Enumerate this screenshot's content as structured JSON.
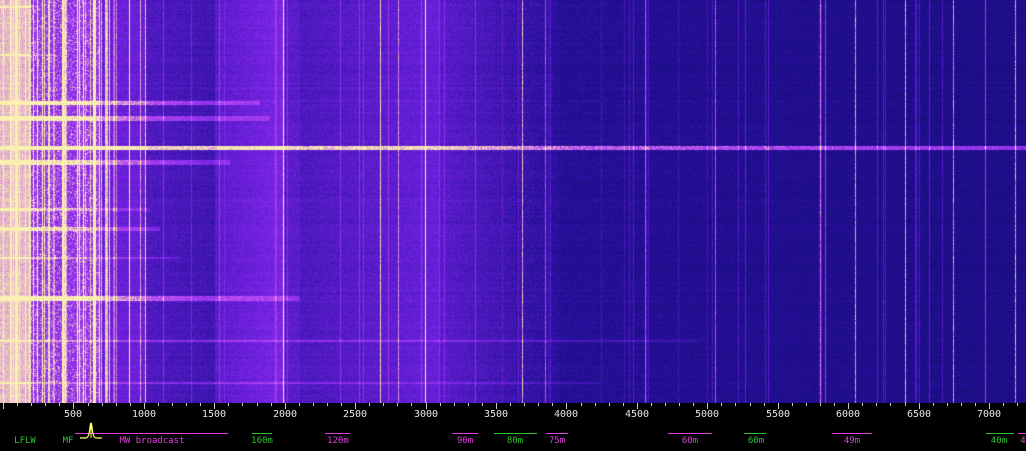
{
  "waterfall": {
    "unit_hint": "kHz",
    "colors": {
      "background": "#0a0a50",
      "mid": "#6a22d8",
      "hot": "#b040f0",
      "peak": "#f0f0b0"
    }
  },
  "frequency_scale": {
    "labels": [
      "500",
      "1000",
      "1500",
      "2000",
      "2500",
      "3000",
      "3500",
      "4000",
      "4500",
      "5000",
      "5500",
      "6000",
      "6500",
      "7000"
    ],
    "values_khz": [
      500,
      1000,
      1500,
      2000,
      2500,
      3000,
      3500,
      4000,
      4500,
      5000,
      5500,
      6000,
      6500,
      7000
    ]
  },
  "bands": [
    {
      "id": "lflw",
      "label": "LFLW",
      "color": "#2ec42e"
    },
    {
      "id": "mf",
      "label": "MF",
      "color": "#2ec42e"
    },
    {
      "id": "mw",
      "label": "MW broadcast",
      "color": "#e040e0"
    },
    {
      "id": "160m",
      "label": "160m",
      "color": "#2ec42e"
    },
    {
      "id": "120m",
      "label": "120m",
      "color": "#e040e0"
    },
    {
      "id": "90m",
      "label": "90m",
      "color": "#e040e0"
    },
    {
      "id": "80m",
      "label": "80m",
      "color": "#2ec42e"
    },
    {
      "id": "75m",
      "label": "75m",
      "color": "#e040e0"
    },
    {
      "id": "60m-bc",
      "label": "60m",
      "color": "#e040e0"
    },
    {
      "id": "60m-ham",
      "label": "60m",
      "color": "#2ec42e"
    },
    {
      "id": "49m",
      "label": "49m",
      "color": "#e040e0"
    },
    {
      "id": "40m",
      "label": "40m",
      "color": "#2ec42e"
    },
    {
      "id": "41m",
      "label": "4",
      "color": "#e040e0"
    }
  ],
  "passband": {
    "color": "#ffff60"
  }
}
